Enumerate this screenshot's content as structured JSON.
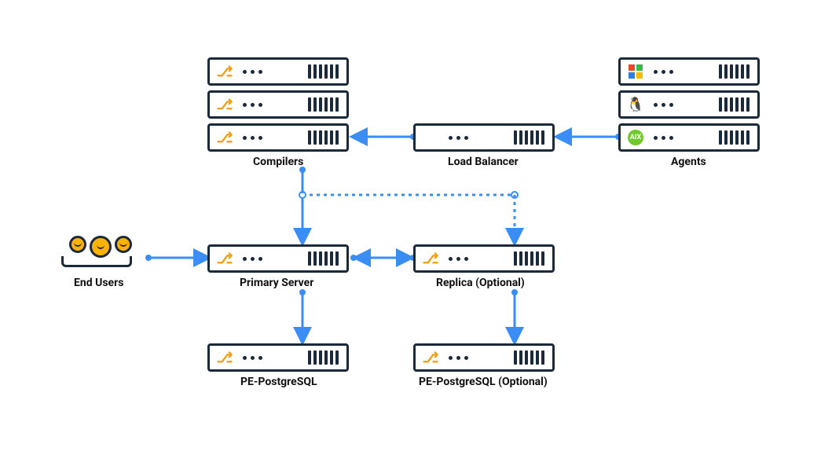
{
  "labels": {
    "compilers": "Compilers",
    "loadbalancer": "Load Balancer",
    "agents": "Agents",
    "endusers": "End Users",
    "primary": "Primary Server",
    "replica": "Replica (Optional)",
    "pg1": "PE-PostgreSQL",
    "pg2": "PE-PostgreSQL (Optional)"
  },
  "icons": {
    "puppet": "⎇",
    "windows": "win",
    "linux": "🐧",
    "aix": "AIX"
  },
  "colors": {
    "arrow": "#3a8df5",
    "stroke": "#1b2a3a"
  }
}
